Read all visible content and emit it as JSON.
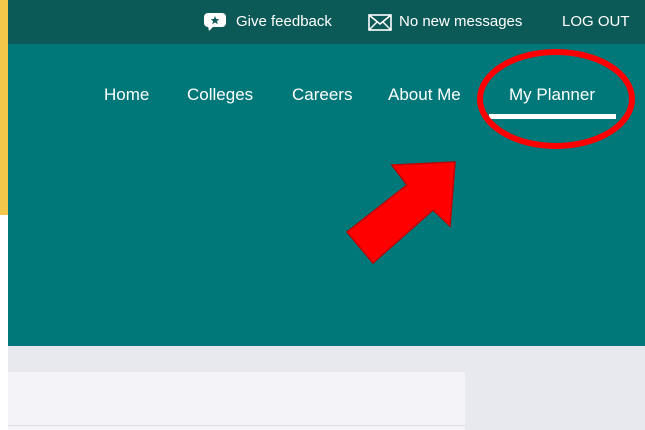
{
  "topbar": {
    "feedback_label": "Give feedback",
    "messages_label": "No new messages",
    "logout_label": "LOG OUT"
  },
  "nav": {
    "items": [
      {
        "label": "Home"
      },
      {
        "label": "Colleges"
      },
      {
        "label": "Careers"
      },
      {
        "label": "About Me"
      },
      {
        "label": "My Planner",
        "active": true
      }
    ]
  },
  "colors": {
    "topbar": "#0c5a58",
    "hero": "#00787a",
    "accent_strip": "#f3c84a",
    "annotation": "#ff0000"
  },
  "annotations": {
    "highlight": "red-ellipse-around-my-planner",
    "pointer": "red-arrow-pointing-to-my-planner"
  }
}
